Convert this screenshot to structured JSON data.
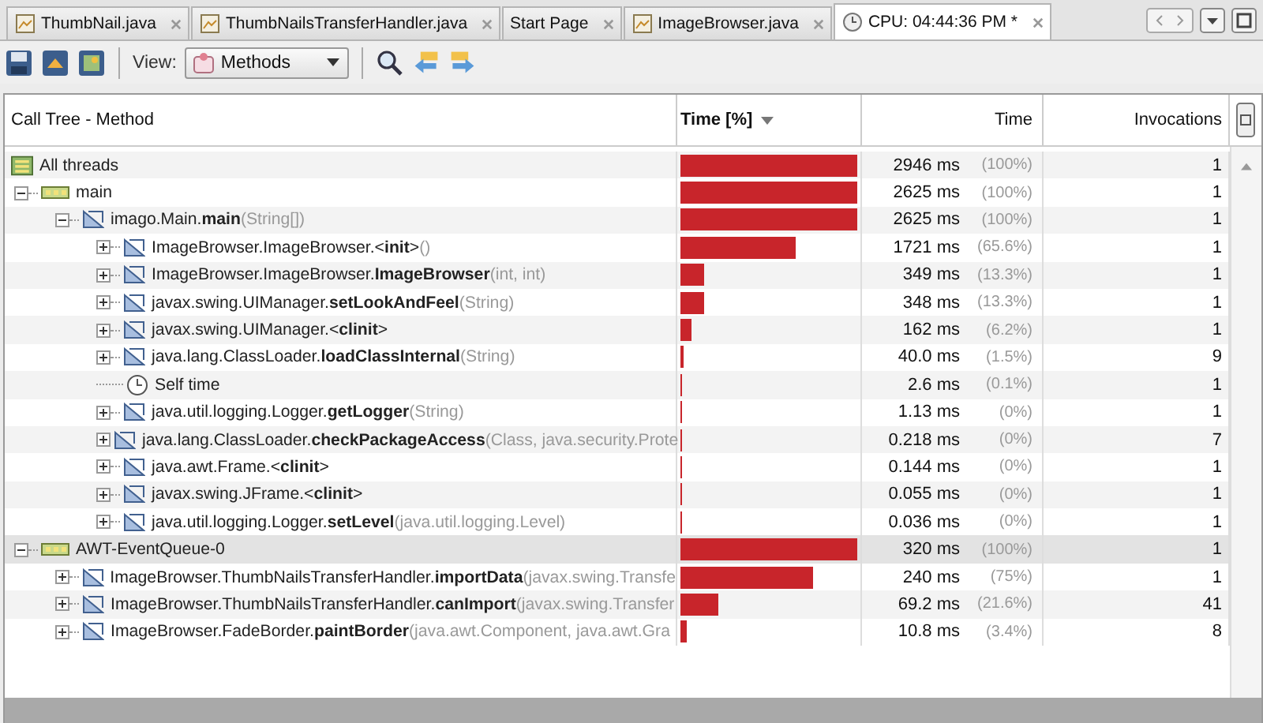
{
  "tabs": [
    {
      "label": "ThumbNail.java",
      "kind": "file",
      "selected": false
    },
    {
      "label": "ThumbNailsTransferHandler.java",
      "kind": "file",
      "selected": false
    },
    {
      "label": "Start Page",
      "kind": "page",
      "selected": false
    },
    {
      "label": "ImageBrowser.java",
      "kind": "file",
      "selected": false
    },
    {
      "label": "CPU: 04:44:36 PM *",
      "kind": "profiler",
      "selected": true
    }
  ],
  "toolbar": {
    "view_label": "View:",
    "view_value": "Methods"
  },
  "columns": [
    {
      "label": "Call Tree - Method",
      "sorted": false
    },
    {
      "label": "Time [%]",
      "sorted": true
    },
    {
      "label": "Time",
      "sorted": false
    },
    {
      "label": "Invocations",
      "sorted": false
    }
  ],
  "rows": [
    {
      "kind": "all",
      "name": "All threads",
      "time": "2946 ms",
      "percent": "(100%)",
      "level": 1.0,
      "invocations": "1"
    },
    {
      "kind": "thread",
      "name": "main",
      "expanded": true,
      "time": "2625 ms",
      "percent": "(100%)",
      "level": 1.0,
      "invocations": "1",
      "children": [
        {
          "kind": "method",
          "name": "imago.Main.**main**",
          "args": "(String[])",
          "expanded": true,
          "time": "2625 ms",
          "percent": "(100%)",
          "level": 1.0,
          "invocations": "1",
          "children": [
            {
              "kind": "method",
              "name": "ImageBrowser.ImageBrowser.<**init**>",
              "args": "()",
              "expanded": false,
              "time": "1721 ms",
              "percent": "(65.6%)",
              "level": 0.656,
              "invocations": "1"
            },
            {
              "kind": "method",
              "name": "ImageBrowser.ImageBrowser.**ImageBrowser**",
              "args": "(int, int)",
              "expanded": false,
              "time": "349 ms",
              "percent": "(13.3%)",
              "level": 0.133,
              "invocations": "1"
            },
            {
              "kind": "method",
              "name": "javax.swing.UIManager.**setLookAndFeel**",
              "args": "(String)",
              "expanded": false,
              "time": "348 ms",
              "percent": "(13.3%)",
              "level": 0.133,
              "invocations": "1"
            },
            {
              "kind": "method",
              "name": "javax.swing.UIManager.<**clinit**>",
              "expanded": false,
              "time": "162 ms",
              "percent": "(6.2%)",
              "level": 0.062,
              "invocations": "1"
            },
            {
              "kind": "method",
              "name": "java.lang.ClassLoader.**loadClassInternal**",
              "args": "(String)",
              "expanded": false,
              "time": "40.0 ms",
              "percent": "(1.5%)",
              "level": 0.015,
              "invocations": "9"
            },
            {
              "kind": "self",
              "name": "Self time",
              "time": "2.6 ms",
              "percent": "(0.1%)",
              "level": 0.001,
              "invocations": "1"
            },
            {
              "kind": "method",
              "name": "java.util.logging.Logger.**getLogger**",
              "args": "(String)",
              "expanded": false,
              "time": "1.13 ms",
              "percent": "(0%)",
              "level": 0,
              "invocations": "1"
            },
            {
              "kind": "method",
              "name": "java.lang.ClassLoader.**checkPackageAccess**",
              "args": "(Class, java.security.Prote",
              "expanded": false,
              "time": "0.218 ms",
              "percent": "(0%)",
              "level": 0,
              "invocations": "7"
            },
            {
              "kind": "method",
              "name": "java.awt.Frame.<**clinit**>",
              "expanded": false,
              "time": "0.144 ms",
              "percent": "(0%)",
              "level": 0,
              "invocations": "1"
            },
            {
              "kind": "method",
              "name": "javax.swing.JFrame.<**clinit**>",
              "expanded": false,
              "time": "0.055 ms",
              "percent": "(0%)",
              "level": 0,
              "invocations": "1"
            },
            {
              "kind": "method",
              "name": "java.util.logging.Logger.**setLevel**",
              "args": "(java.util.logging.Level)",
              "expanded": false,
              "time": "0.036 ms",
              "percent": "(0%)",
              "level": 0,
              "invocations": "1"
            }
          ]
        }
      ]
    },
    {
      "kind": "thread",
      "name": "AWT-EventQueue-0",
      "expanded": true,
      "time": "320 ms",
      "percent": "(100%)",
      "level": 1.0,
      "invocations": "1",
      "children": [
        {
          "kind": "method",
          "name": "ImageBrowser.ThumbNailsTransferHandler.**importData**",
          "args": "(javax.swing.Transfe",
          "expanded": false,
          "time": "240 ms",
          "percent": "(75%)",
          "level": 0.75,
          "invocations": "1"
        },
        {
          "kind": "method",
          "name": "ImageBrowser.ThumbNailsTransferHandler.**canImport**",
          "args": "(javax.swing.Transfer",
          "expanded": false,
          "time": "69.2 ms",
          "percent": "(21.6%)",
          "level": 0.216,
          "invocations": "41"
        },
        {
          "kind": "method",
          "name": "ImageBrowser.FadeBorder.**paintBorder**",
          "args": "(java.awt.Component, java.awt.Gra",
          "expanded": false,
          "time": "10.8 ms",
          "percent": "(3.4%)",
          "level": 0.034,
          "invocations": "8"
        }
      ]
    }
  ]
}
